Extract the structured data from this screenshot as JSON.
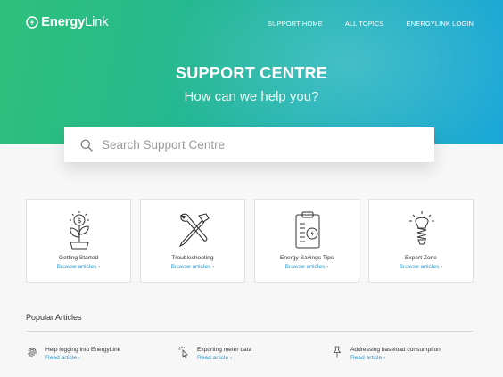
{
  "brand": {
    "name_bold": "Energy",
    "name_light": "Link"
  },
  "nav": {
    "items": [
      "SUPPORT HOME",
      "ALL TOPICS",
      "ENERGYLINK LOGIN"
    ]
  },
  "hero": {
    "title": "SUPPORT CENTRE",
    "subtitle": "How can we help you?"
  },
  "search": {
    "placeholder": "Search Support Centre",
    "value": ""
  },
  "cards": [
    {
      "title": "Getting Started",
      "link": "Browse articles ›",
      "icon": "money-plant-icon"
    },
    {
      "title": "Troubleshooting",
      "link": "Browse articles ›",
      "icon": "wrench-hammer-icon"
    },
    {
      "title": "Energy Savings Tips",
      "link": "Browse articles ›",
      "icon": "clipboard-chart-icon"
    },
    {
      "title": "Expert Zone",
      "link": "Browse articles ›",
      "icon": "lightbulb-icon"
    }
  ],
  "popular": {
    "title": "Popular Articles",
    "articles": [
      {
        "title": "Help logging into EnergyLink",
        "link": "Read  article  ›",
        "icon": "fingerprint-icon"
      },
      {
        "title": "Exporting meter data",
        "link": "Read  article  ›",
        "icon": "cursor-click-icon"
      },
      {
        "title": "Addressing baseload consumption",
        "link": "Read  article  ›",
        "icon": "pushpin-icon"
      }
    ]
  },
  "colors": {
    "accent_link": "#2a9ad1",
    "hero_start": "#2ec07a",
    "hero_end": "#1aa7d8"
  }
}
